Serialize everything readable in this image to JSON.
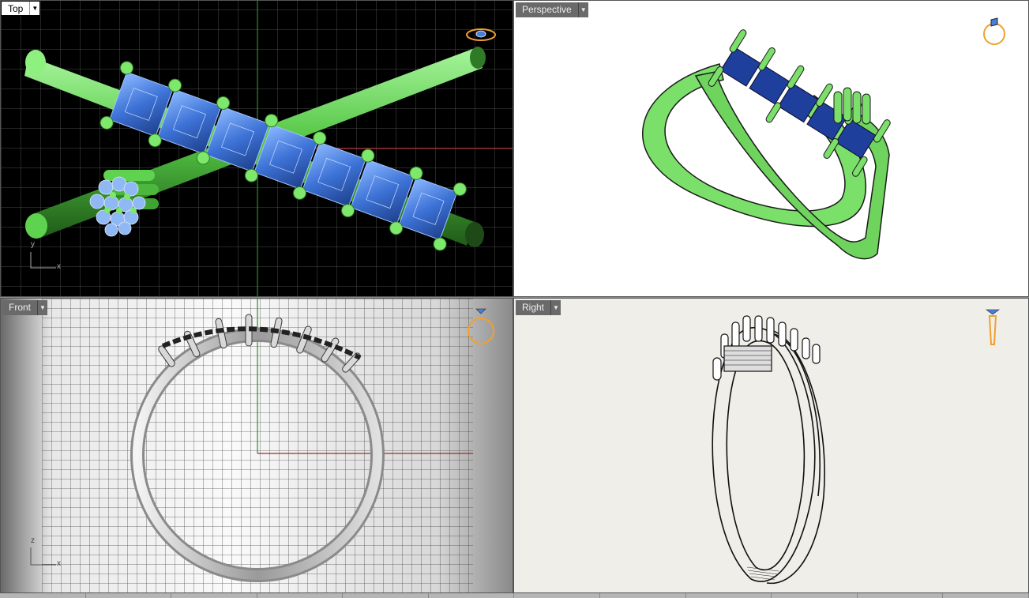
{
  "viewports": {
    "top": {
      "label": "Top",
      "axis_x": "x",
      "axis_y": "y",
      "icon": "ring-top-view-icon"
    },
    "perspective": {
      "label": "Perspective",
      "icon": "ring-perspective-icon"
    },
    "front": {
      "label": "Front",
      "axis_x": "x",
      "axis_y": "z",
      "icon": "ring-front-view-icon"
    },
    "right": {
      "label": "Right",
      "icon": "ring-right-view-icon"
    }
  },
  "dropdown_glyph": "▼",
  "colors": {
    "metal_green": "#7be06a",
    "gem_blue": "#4a7fd4",
    "grid_line": "#555555",
    "axis_red": "#b03030",
    "axis_green": "#30a030",
    "gizmo_orange": "#f0a030"
  }
}
